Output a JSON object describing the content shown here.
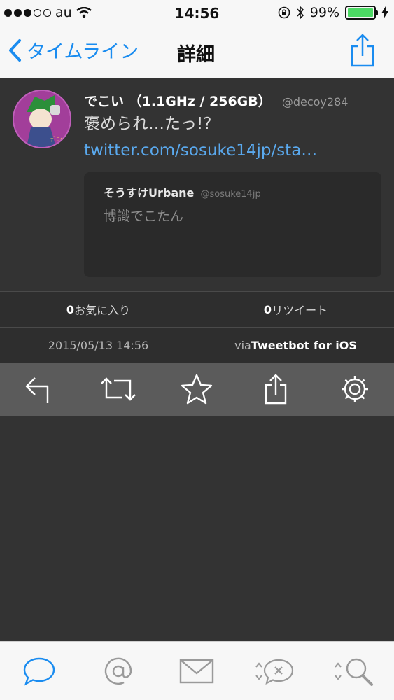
{
  "status_bar": {
    "carrier": "au",
    "time": "14:56",
    "battery_percent": "99%",
    "battery_level": 0.99,
    "signal_bars_filled": 3,
    "signal_bars_total": 5
  },
  "nav": {
    "back_label": "タイムライン",
    "title": "詳細",
    "accent_color": "#1a8cf0"
  },
  "tweet": {
    "display_name": "でこい （1.1GHz / 256GB）",
    "username": "@decoy284",
    "text": "褒められ…たっ!? ",
    "link_text": "twitter.com/sosuke14jp/sta…",
    "quote": {
      "author": "そうすけUrbane",
      "username": "@sosuke14jp",
      "text": "博識でこたん"
    }
  },
  "stats": {
    "favorites_count": "0",
    "favorites_label": "お気に入り",
    "retweets_count": "0",
    "retweets_label": "リツイート",
    "timestamp": "2015/05/13 14:56",
    "via_prefix": "via ",
    "client": "Tweetbot for iOS"
  },
  "actions": [
    "reply-icon",
    "retweet-icon",
    "favorite-star-icon",
    "share-icon",
    "settings-gear-icon"
  ],
  "tabs": [
    "timeline-bubble-icon",
    "mentions-at-icon",
    "messages-envelope-icon",
    "retweets-icon",
    "search-icon"
  ]
}
